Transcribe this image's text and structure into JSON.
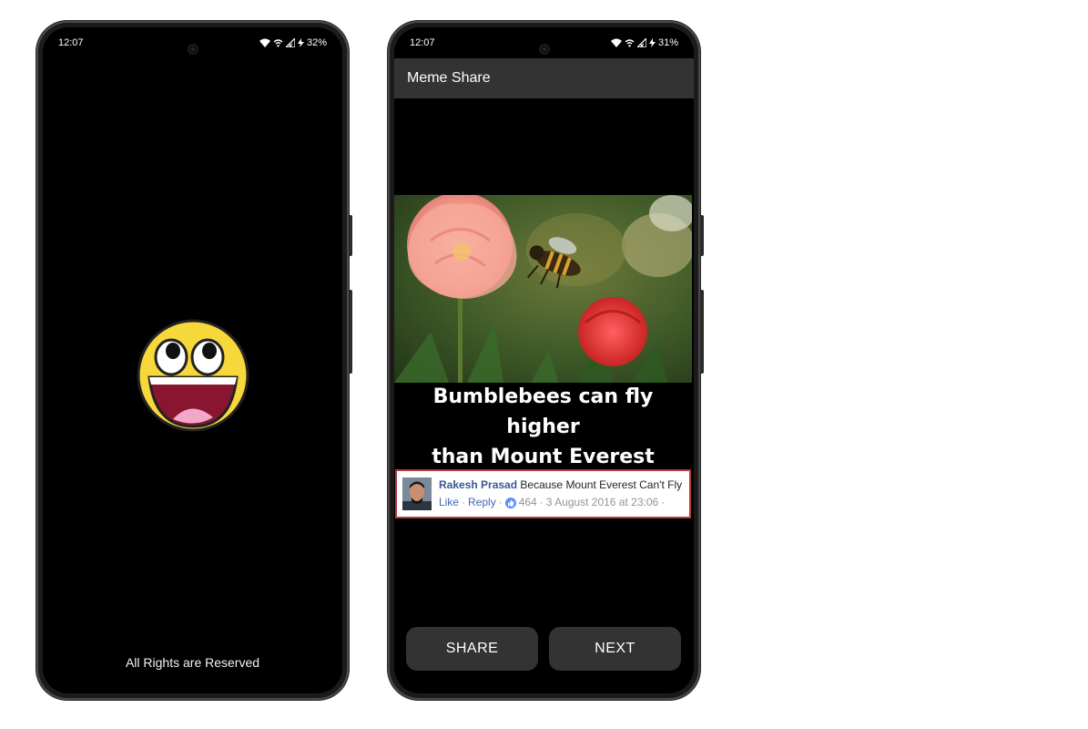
{
  "left_phone": {
    "status": {
      "time": "12:07",
      "battery": "32%"
    },
    "footer_text": "All Rights are Reserved",
    "logo_icon": "awesome-smiley-icon"
  },
  "right_phone": {
    "status": {
      "time": "12:07",
      "battery": "31%"
    },
    "app_title": "Meme Share",
    "meme": {
      "caption_line1": "Bumblebees can fly higher",
      "caption_line2": "than Mount Everest",
      "comment": {
        "author": "Rakesh Prasad",
        "text": "Because Mount Everest Can't Fly",
        "like_label": "Like",
        "reply_label": "Reply",
        "like_count": "464",
        "timestamp": "3 August 2016 at 23:06"
      }
    },
    "buttons": {
      "share_label": "SHARE",
      "next_label": "NEXT"
    }
  },
  "colors": {
    "app_bar": "#333333",
    "button_bg": "#333333",
    "screen_bg": "#000000",
    "smiley_yellow": "#f7d83a",
    "comment_author": "#365899"
  }
}
